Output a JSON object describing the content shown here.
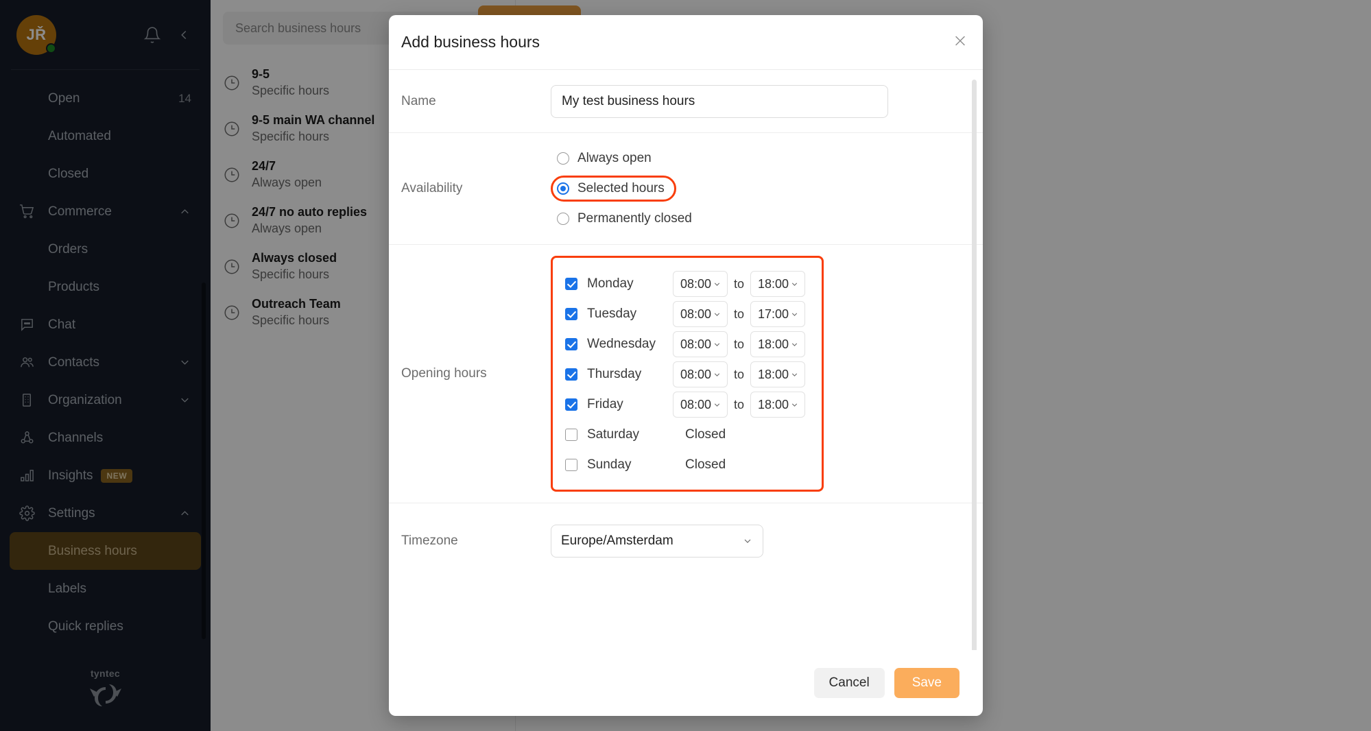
{
  "sidebar": {
    "avatar_initials": "JŘ",
    "icons": {
      "bell": "bell-icon",
      "collapse": "chevron-left-icon"
    },
    "items": [
      {
        "label": "Open",
        "count": "14",
        "icon": "",
        "sub": true,
        "chevron": "",
        "active": false
      },
      {
        "label": "Automated",
        "count": "",
        "icon": "",
        "sub": true,
        "chevron": "",
        "active": false
      },
      {
        "label": "Closed",
        "count": "",
        "icon": "",
        "sub": true,
        "chevron": "",
        "active": false
      },
      {
        "label": "Commerce",
        "count": "",
        "icon": "cart-icon",
        "sub": false,
        "chevron": "up",
        "active": false
      },
      {
        "label": "Orders",
        "count": "",
        "icon": "",
        "sub": true,
        "chevron": "",
        "active": false
      },
      {
        "label": "Products",
        "count": "",
        "icon": "",
        "sub": true,
        "chevron": "",
        "active": false
      },
      {
        "label": "Chat",
        "count": "",
        "icon": "chat-bubble-icon",
        "sub": false,
        "chevron": "",
        "active": false
      },
      {
        "label": "Contacts",
        "count": "",
        "icon": "people-icon",
        "sub": false,
        "chevron": "down",
        "active": false
      },
      {
        "label": "Organization",
        "count": "",
        "icon": "building-icon",
        "sub": false,
        "chevron": "down",
        "active": false
      },
      {
        "label": "Channels",
        "count": "",
        "icon": "channels-icon",
        "sub": false,
        "chevron": "",
        "active": false
      },
      {
        "label": "Insights",
        "count": "",
        "icon": "bar-chart-icon",
        "sub": false,
        "chevron": "",
        "active": false,
        "badge": "NEW"
      },
      {
        "label": "Settings",
        "count": "",
        "icon": "gear-icon",
        "sub": false,
        "chevron": "up",
        "active": false
      },
      {
        "label": "Business hours",
        "count": "",
        "icon": "",
        "sub": true,
        "chevron": "",
        "active": true
      },
      {
        "label": "Labels",
        "count": "",
        "icon": "",
        "sub": true,
        "chevron": "",
        "active": false
      },
      {
        "label": "Quick replies",
        "count": "",
        "icon": "",
        "sub": true,
        "chevron": "",
        "active": false
      }
    ],
    "brand": "tyntec"
  },
  "list_panel": {
    "search_placeholder": "Search business hours",
    "items": [
      {
        "title": "9-5",
        "subtitle": "Specific hours"
      },
      {
        "title": "9-5 main WA channel",
        "subtitle": "Specific hours"
      },
      {
        "title": "24/7",
        "subtitle": "Always open"
      },
      {
        "title": "24/7 no auto replies",
        "subtitle": "Always open"
      },
      {
        "title": "Always closed",
        "subtitle": "Specific hours"
      },
      {
        "title": "Outreach Team",
        "subtitle": "Specific hours"
      }
    ]
  },
  "modal": {
    "title": "Add business hours",
    "close_icon": "close-icon",
    "name": {
      "label": "Name",
      "value": "My test business hours"
    },
    "availability": {
      "label": "Availability",
      "options": [
        {
          "label": "Always open",
          "selected": false,
          "annotated": false
        },
        {
          "label": "Selected hours",
          "selected": true,
          "annotated": true
        },
        {
          "label": "Permanently closed",
          "selected": false,
          "annotated": false
        }
      ]
    },
    "opening_hours": {
      "label": "Opening hours",
      "to_word": "to",
      "closed_word": "Closed",
      "annotated": true,
      "days": [
        {
          "day": "Monday",
          "checked": true,
          "from": "08:00",
          "to": "18:00"
        },
        {
          "day": "Tuesday",
          "checked": true,
          "from": "08:00",
          "to": "17:00"
        },
        {
          "day": "Wednesday",
          "checked": true,
          "from": "08:00",
          "to": "18:00"
        },
        {
          "day": "Thursday",
          "checked": true,
          "from": "08:00",
          "to": "18:00"
        },
        {
          "day": "Friday",
          "checked": true,
          "from": "08:00",
          "to": "18:00"
        },
        {
          "day": "Saturday",
          "checked": false,
          "from": "",
          "to": ""
        },
        {
          "day": "Sunday",
          "checked": false,
          "from": "",
          "to": ""
        }
      ]
    },
    "timezone": {
      "label": "Timezone",
      "value": "Europe/Amsterdam"
    },
    "footer": {
      "cancel_label": "Cancel",
      "save_label": "Save"
    }
  },
  "colors": {
    "sidebar_bg": "#161C28",
    "accent_orange": "#FBAD5C",
    "annotation_red": "#F93E0C",
    "checkbox_blue": "#1A73E8",
    "active_nav": "#5E4518"
  }
}
